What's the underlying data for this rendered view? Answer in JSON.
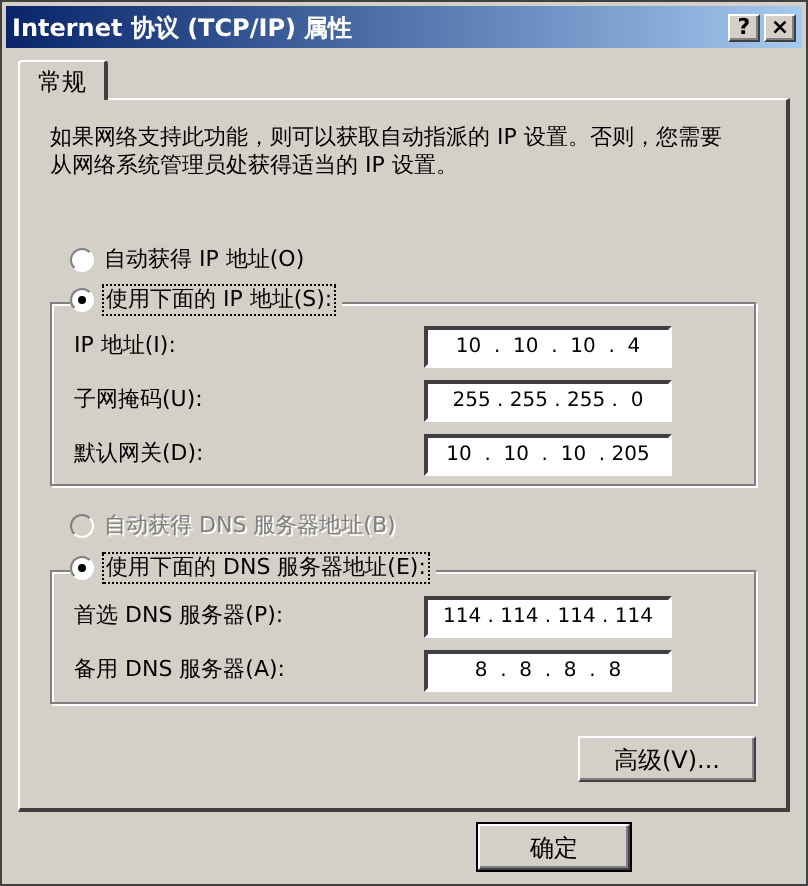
{
  "window": {
    "title": "Internet 协议 (TCP/IP) 属性",
    "buttons": [
      {
        "kind": "help",
        "label": "?"
      },
      {
        "kind": "close",
        "label": "×"
      }
    ]
  },
  "tabs": [
    {
      "label": "常规",
      "selected": true
    }
  ],
  "description": "如果网络支持此功能，则可以获取自动指派的 IP 设置。否则，您需要从网络系统管理员处获得适当的 IP 设置。",
  "ip_mode": [
    {
      "label": "自动获得 IP 地址(O)",
      "selected": false,
      "disabled": false
    },
    {
      "label": "使用下面的 IP 地址(S):",
      "selected": true,
      "disabled": false
    }
  ],
  "ip_fields": [
    {
      "label": "IP 地址(I):",
      "value": "10  .  10  .  10  .  4"
    },
    {
      "label": "子网掩码(U):",
      "value": "255 . 255 . 255 .  0"
    },
    {
      "label": "默认网关(D):",
      "value": "10  .  10  .  10  . 205"
    }
  ],
  "dns_mode": [
    {
      "label": "自动获得 DNS 服务器地址(B)",
      "selected": false,
      "disabled": true
    },
    {
      "label": "使用下面的 DNS 服务器地址(E):",
      "selected": true,
      "disabled": false
    }
  ],
  "dns_fields": [
    {
      "label": "首选 DNS 服务器(P):",
      "value": "114 . 114 . 114 . 114"
    },
    {
      "label": "备用 DNS 服务器(A):",
      "value": "8  .  8  .  8  .  8"
    }
  ],
  "advanced_button": "高级(V)...",
  "dialog_buttons": [
    "确定"
  ]
}
